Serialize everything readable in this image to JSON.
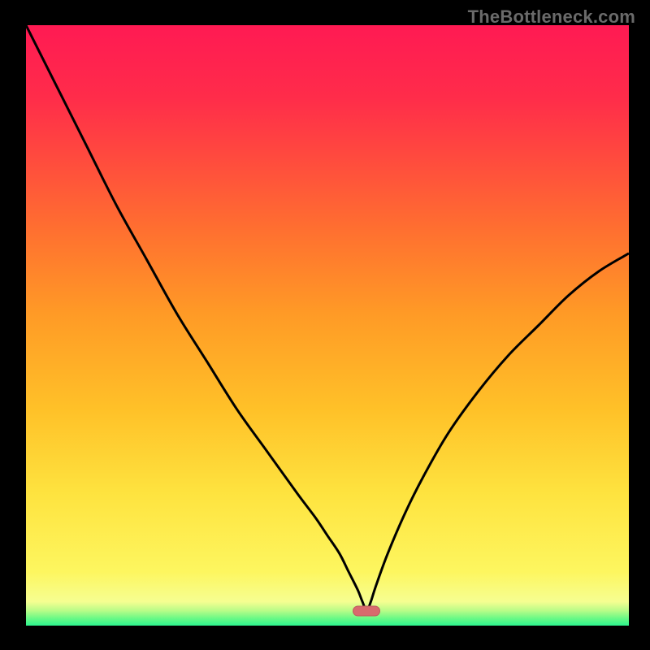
{
  "watermark": "TheBottleneck.com",
  "marker": {
    "x_pct": 56.5,
    "y_pct": 97.5,
    "color": "#d86a6d"
  },
  "colors": {
    "curve_stroke": "#000000",
    "background_matte": "#000000"
  },
  "chart_data": {
    "type": "line",
    "title": "",
    "xlabel": "",
    "ylabel": "",
    "xlim": [
      0,
      100
    ],
    "ylim": [
      0,
      100
    ],
    "grid": false,
    "legend": false,
    "annotations": [
      {
        "kind": "minimum-marker",
        "x": 56.5,
        "y": 2.5
      }
    ],
    "series": [
      {
        "name": "bottleneck-curve",
        "x": [
          0,
          5,
          10,
          15,
          20,
          25,
          30,
          35,
          40,
          45,
          48,
          50,
          52,
          53.5,
          55,
          55.8,
          56.5,
          57.2,
          58,
          60,
          63,
          66,
          70,
          75,
          80,
          85,
          90,
          95,
          100
        ],
        "y": [
          100,
          90,
          80,
          70,
          61,
          52,
          44,
          36,
          29,
          22,
          18,
          15,
          12,
          9,
          6,
          4,
          2.5,
          4,
          6.5,
          12,
          19,
          25,
          32,
          39,
          45,
          50,
          55,
          59,
          62
        ]
      }
    ]
  }
}
